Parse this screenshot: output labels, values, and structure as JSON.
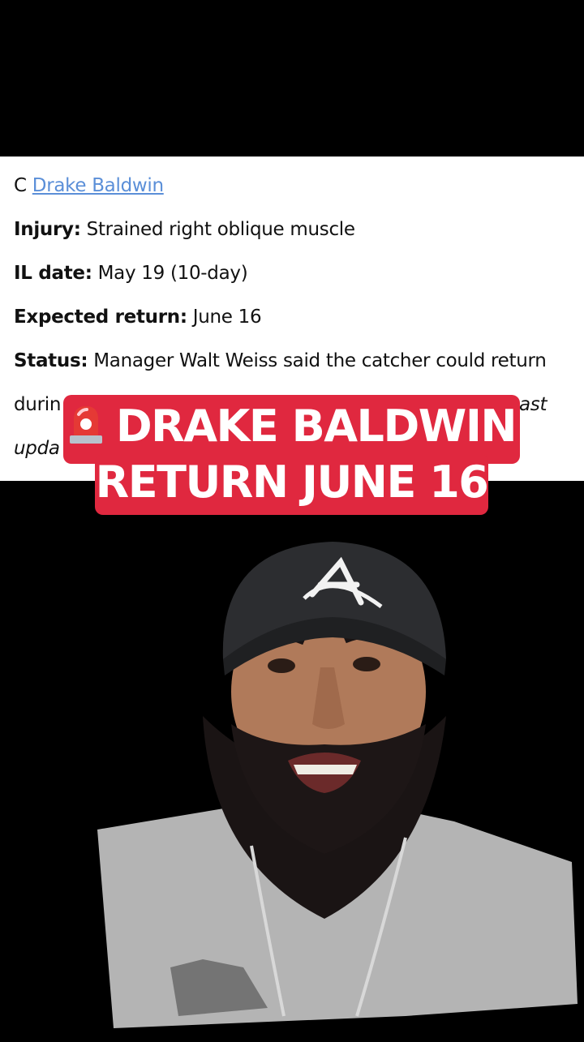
{
  "article": {
    "position": "C",
    "player_name": "Drake Baldwin",
    "injury_label": "Injury:",
    "injury_value": "Strained right oblique muscle",
    "il_label": "IL date:",
    "il_value": "May 19 (10-day)",
    "return_label": "Expected return:",
    "return_value": "June 16",
    "status_label": "Status:",
    "status_value": "Manager Walt Weiss said the catcher could return",
    "status_cont_start": "durin",
    "status_cont_end": "ast",
    "updated_fragment": "upda"
  },
  "caption": {
    "line1": "DRAKE BALDWIN",
    "line2": "RETURN JUNE 16",
    "icon": "siren-icon",
    "color": "#e0283f"
  },
  "colors": {
    "link": "#5b8fd8",
    "background": "#000000",
    "card": "#ffffff"
  }
}
